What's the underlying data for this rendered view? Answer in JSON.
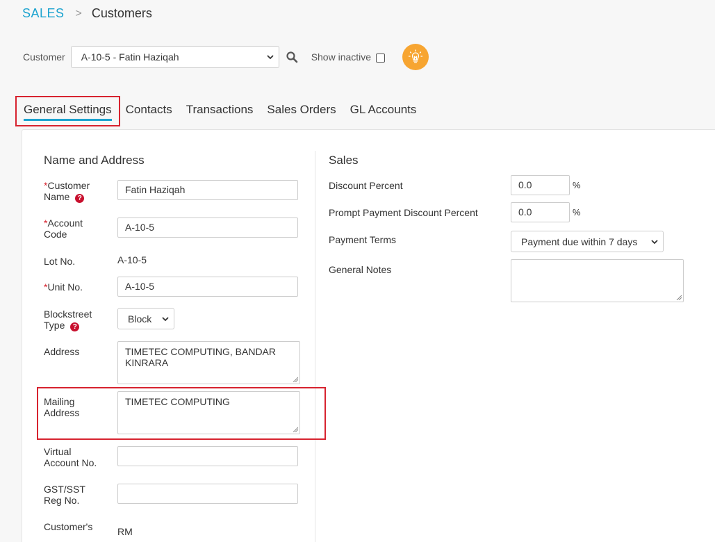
{
  "breadcrumb": {
    "module": "SALES",
    "page": "Customers"
  },
  "toolbar": {
    "customer_label": "Customer",
    "customer_value": "A-10-5 - Fatin Haziqah",
    "show_inactive_label": "Show inactive"
  },
  "tabs": [
    "General Settings",
    "Contacts",
    "Transactions",
    "Sales Orders",
    "GL Accounts"
  ],
  "name_address": {
    "title": "Name and Address",
    "customer_name": {
      "label": "Customer Name",
      "value": "Fatin Haziqah"
    },
    "account_code": {
      "label": "Account Code",
      "value": "A-10-5"
    },
    "lot_no": {
      "label": "Lot No.",
      "value": "A-10-5"
    },
    "unit_no": {
      "label": "Unit No.",
      "value": "A-10-5"
    },
    "blockstreet_type": {
      "label": "Blockstreet Type",
      "value": "Block"
    },
    "address": {
      "label": "Address",
      "value": "TIMETEC COMPUTING, BANDAR KINRARA"
    },
    "mailing_address": {
      "label": "Mailing Address",
      "value": "TIMETEC COMPUTING"
    },
    "virtual_account": {
      "label": "Virtual Account No.",
      "value": ""
    },
    "gst_reg": {
      "label": "GST/SST Reg No.",
      "value": ""
    },
    "currency": {
      "label": "Customer's",
      "value": "RM"
    }
  },
  "sales": {
    "title": "Sales",
    "discount_percent": {
      "label": "Discount Percent",
      "value": "0.0",
      "unit": "%"
    },
    "prompt_discount": {
      "label": "Prompt Payment Discount Percent",
      "value": "0.0",
      "unit": "%"
    },
    "payment_terms": {
      "label": "Payment Terms",
      "value": "Payment due within 7 days"
    },
    "general_notes": {
      "label": "General Notes",
      "value": ""
    }
  },
  "colors": {
    "accent": "#1ba3cf",
    "highlight": "#d7232f",
    "bulb": "#f7a531"
  }
}
